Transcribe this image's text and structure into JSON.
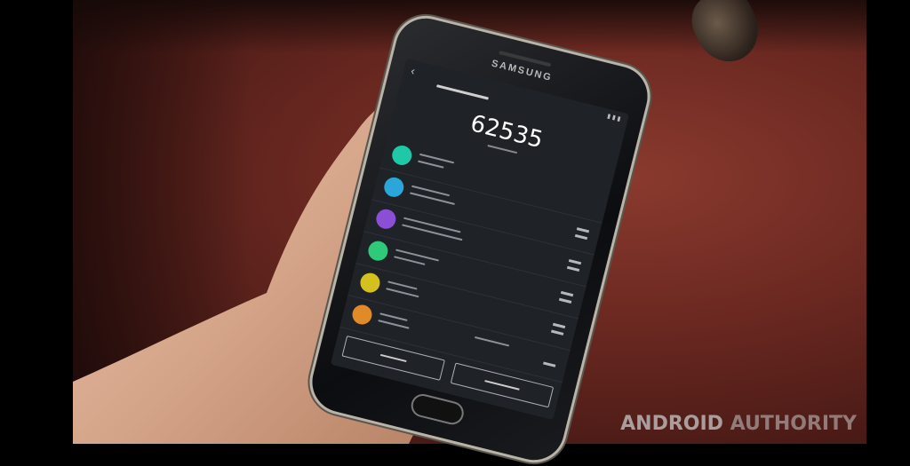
{
  "phone": {
    "brand": "SAMSUNG",
    "screen": {
      "score": "62535",
      "categories": [
        {
          "color": "#1fc9a8"
        },
        {
          "color": "#2aa6d8"
        },
        {
          "color": "#8b4fd6"
        },
        {
          "color": "#2fc97a"
        },
        {
          "color": "#d4c11d"
        },
        {
          "color": "#e08a2a"
        }
      ]
    }
  },
  "watermark": {
    "part1": "ANDROID",
    "part2": "AUTHORITY"
  }
}
